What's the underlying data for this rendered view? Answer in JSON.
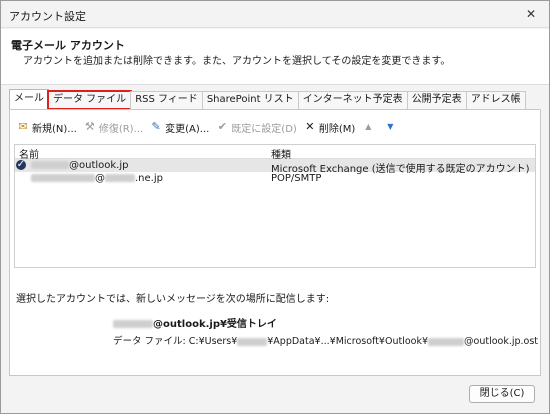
{
  "window": {
    "title": "アカウント設定",
    "close_glyph": "✕"
  },
  "header": {
    "title": "電子メール アカウント",
    "description": "アカウントを追加または削除できます。また、アカウントを選択してその設定を変更できます。"
  },
  "tabs": [
    {
      "label": "メール"
    },
    {
      "label": "データ ファイル"
    },
    {
      "label": "RSS フィード"
    },
    {
      "label": "SharePoint リスト"
    },
    {
      "label": "インターネット予定表"
    },
    {
      "label": "公開予定表"
    },
    {
      "label": "アドレス帳"
    }
  ],
  "toolbar": {
    "new": "新規(N)...",
    "repair": "修復(R)...",
    "change": "変更(A)...",
    "default": "既定に設定(D)",
    "delete": "削除(M)",
    "up_glyph": "▲",
    "down_glyph": "▼"
  },
  "list": {
    "col_name": "名前",
    "col_type": "種類",
    "rows": [
      {
        "name_suffix": "@outlook.jp",
        "type": "Microsoft Exchange (送信で使用する既定のアカウント)"
      },
      {
        "name_at": "@",
        "name_suffix": ".ne.jp",
        "type": "POP/SMTP"
      }
    ]
  },
  "delivery": {
    "label": "選択したアカウントでは、新しいメッセージを次の場所に配信します:",
    "destination": "@outlook.jp¥受信トレイ",
    "file_prefix": "データ ファイル: C:¥Users¥",
    "file_mid": "¥AppData¥...¥Microsoft¥Outlook¥",
    "file_suffix": "@outlook.jp.ost"
  },
  "footer": {
    "close_button": "閉じる(C)"
  }
}
